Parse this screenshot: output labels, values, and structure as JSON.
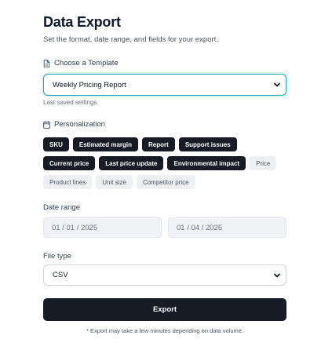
{
  "header": {
    "title": "Data Export",
    "subtitle": "Set the format, date range, and fields for your export."
  },
  "template": {
    "label": "Choose a Template",
    "selected": "Weekly Pricing Report",
    "helper": "Last saved settings",
    "icon": "document-icon"
  },
  "personalization": {
    "label": "Personalization",
    "icon": "calendar-icon",
    "chips_row1": [
      {
        "label": "SKU",
        "selected": true
      },
      {
        "label": "Estimated margin",
        "selected": true
      },
      {
        "label": "Report",
        "selected": true
      },
      {
        "label": "Support issues",
        "selected": true
      }
    ],
    "chips_row2": [
      {
        "label": "Current price",
        "selected": true
      },
      {
        "label": "Last price update",
        "selected": true
      },
      {
        "label": "Environmental impact",
        "selected": true
      },
      {
        "label": "Price",
        "selected": false
      }
    ],
    "chips_row3": [
      {
        "label": "Product lines",
        "selected": false
      },
      {
        "label": "Unit size",
        "selected": false
      },
      {
        "label": "Competitor price",
        "selected": false
      }
    ]
  },
  "date_range": {
    "label": "Date range",
    "start": "01 / 01 / 2025",
    "end": "01 / 04 / 2025"
  },
  "file_type": {
    "label": "File type",
    "selected": "CSV"
  },
  "actions": {
    "export_label": "Export",
    "note": "* Export may take a few minutes depending on data volume."
  },
  "colors": {
    "accent_focus": "#22a7b5",
    "primary": "#161b26",
    "chip_off": "#eef0f3"
  }
}
